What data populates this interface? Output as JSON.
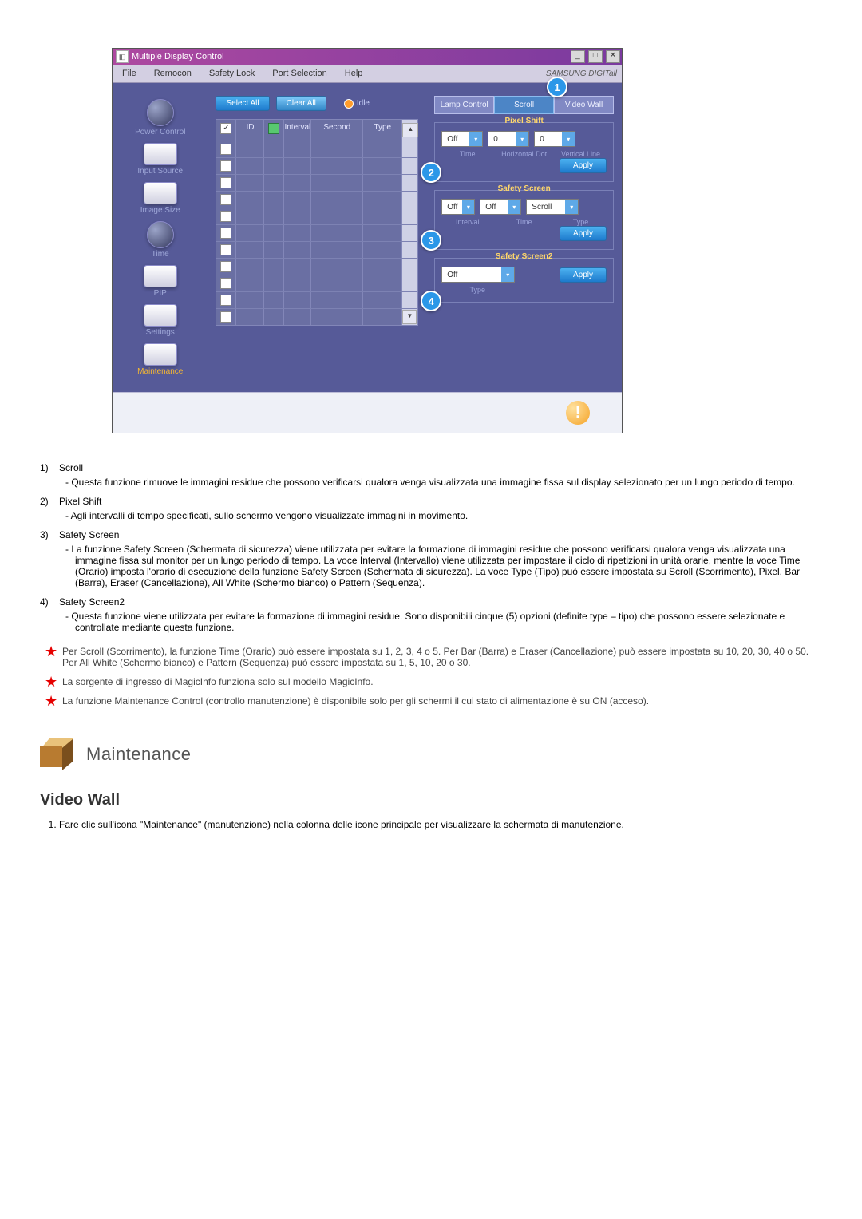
{
  "window": {
    "title": "Multiple Display Control",
    "menus": [
      "File",
      "Remocon",
      "Safety Lock",
      "Port Selection",
      "Help"
    ],
    "brand": "SAMSUNG DIGITall"
  },
  "sidebar": {
    "items": [
      {
        "label": "Power Control"
      },
      {
        "label": "Input Source"
      },
      {
        "label": "Image Size"
      },
      {
        "label": "Time"
      },
      {
        "label": "PIP"
      },
      {
        "label": "Settings"
      },
      {
        "label": "Maintenance",
        "active": true
      }
    ]
  },
  "toolbar": {
    "select_all": "Select All",
    "clear_all": "Clear All",
    "idle": "Idle"
  },
  "table": {
    "headers": {
      "id": "ID",
      "m": "M",
      "interval": "Interval",
      "second": "Second",
      "type": "Type"
    }
  },
  "panel": {
    "tabs": {
      "lamp": "Lamp Control",
      "scroll": "Scroll",
      "video_wall": "Video Wall"
    },
    "pixel_shift": {
      "title": "Pixel Shift",
      "time_val": "Off",
      "hdot_val": "0",
      "vline_val": "0",
      "labels": {
        "time": "Time",
        "hdot": "Horizontal Dot",
        "vline": "Vertical Line"
      },
      "apply": "Apply"
    },
    "safety_screen": {
      "title": "Safety Screen",
      "interval_val": "Off",
      "time_val": "Off",
      "type_val": "Scroll",
      "labels": {
        "interval": "Interval",
        "time": "Time",
        "type": "Type"
      },
      "apply": "Apply"
    },
    "safety_screen2": {
      "title": "Safety Screen2",
      "type_val": "Off",
      "labels": {
        "type": "Type"
      },
      "apply": "Apply"
    },
    "annotations": {
      "a1": "1",
      "a2": "2",
      "a3": "3",
      "a4": "4"
    }
  },
  "doc": {
    "items": [
      {
        "num": "1)",
        "title": "Scroll",
        "body": "Questa funzione rimuove le immagini residue che possono verificarsi qualora venga visualizzata una immagine fissa sul display selezionato per un lungo periodo di tempo."
      },
      {
        "num": "2)",
        "title": "Pixel Shift",
        "body": "Agli intervalli di tempo specificati, sullo schermo vengono visualizzate immagini in movimento."
      },
      {
        "num": "3)",
        "title": "Safety Screen",
        "body": "La funzione Safety Screen (Schermata di sicurezza) viene utilizzata per evitare la formazione di immagini residue che possono verificarsi qualora venga visualizzata una immagine fissa sul monitor per un lungo periodo di tempo. La voce Interval (Intervallo) viene utilizzata per impostare il ciclo di ripetizioni in unità orarie, mentre la voce Time (Orario) imposta l'orario di esecuzione della funzione Safety Screen (Schermata di sicurezza). La voce Type (Tipo) può essere impostata su Scroll (Scorrimento), Pixel, Bar (Barra), Eraser (Cancellazione), All White (Schermo bianco) o Pattern (Sequenza)."
      },
      {
        "num": "4)",
        "title": "Safety Screen2",
        "body": "Questa funzione viene utilizzata per evitare la formazione di immagini residue. Sono disponibili cinque (5) opzioni (definite type – tipo) che possono essere selezionate e controllate mediante questa funzione."
      }
    ],
    "stars": [
      "Per Scroll (Scorrimento), la funzione Time (Orario) può essere impostata su 1, 2, 3, 4 o 5. Per Bar (Barra) e Eraser (Cancellazione) può essere impostata su 10, 20, 30, 40 o 50. Per All White (Schermo bianco) e Pattern (Sequenza) può essere impostata su 1, 5, 10, 20 o 30.",
      "La sorgente di ingresso di MagicInfo funziona solo sul modello MagicInfo.",
      "La funzione Maintenance Control (controllo manutenzione) è disponibile solo per gli schermi il cui stato di alimentazione è su ON (acceso)."
    ],
    "section_title": "Maintenance",
    "subtitle": "Video Wall",
    "subtitle_list": [
      "Fare clic sull'icona \"Maintenance\" (manutenzione) nella colonna delle icone principale per visualizzare la schermata di manutenzione."
    ]
  }
}
